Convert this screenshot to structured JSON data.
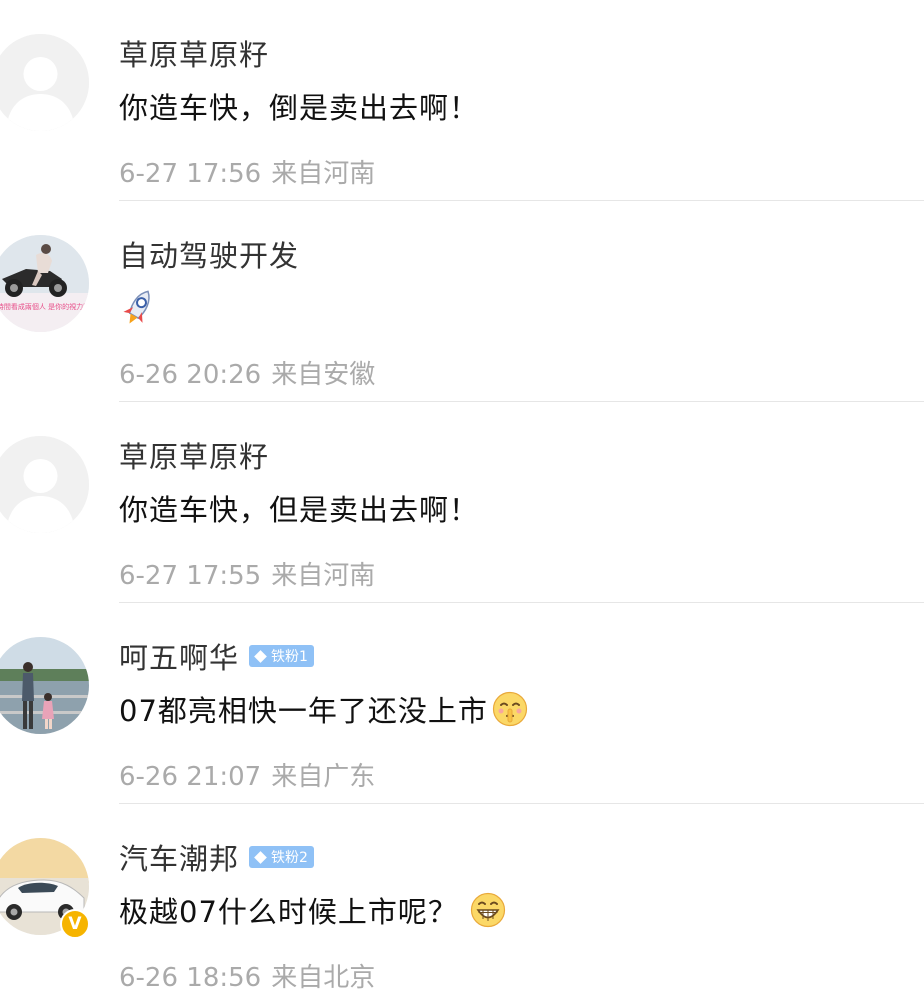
{
  "comments": [
    {
      "username": "草原草原籽",
      "content": "你造车快，倒是卖出去啊！",
      "time": "6-27 17:56",
      "location": "来自河南"
    },
    {
      "username": "自动驾驶开发",
      "content": "",
      "emoji": "rocket-emoji",
      "time": "6-26 20:26",
      "location": "来自安徽",
      "avatar_caption": "第一時間看成兩個人 是你的視力問題"
    },
    {
      "username": "草原草原籽",
      "content": "你造车快，但是卖出去啊！",
      "time": "6-27 17:55",
      "location": "来自河南"
    },
    {
      "username": "呵五啊华",
      "badge": "铁粉1",
      "content": "07都亮相快一年了还没上市",
      "emoji": "shush-emoji",
      "time": "6-26 21:07",
      "location": "来自广东"
    },
    {
      "username": "汽车潮邦",
      "badge": "铁粉2",
      "verified": "V",
      "content": "极越07什么时候上市呢？",
      "emoji": "grin-emoji",
      "time": "6-26 18:56",
      "location": "来自北京"
    }
  ],
  "colors": {
    "username": "#333333",
    "content": "#111111",
    "meta": "#aaaaaa",
    "badge": "#8fc1f6",
    "verified": "#f6b400",
    "divider": "#e6e6e6"
  }
}
